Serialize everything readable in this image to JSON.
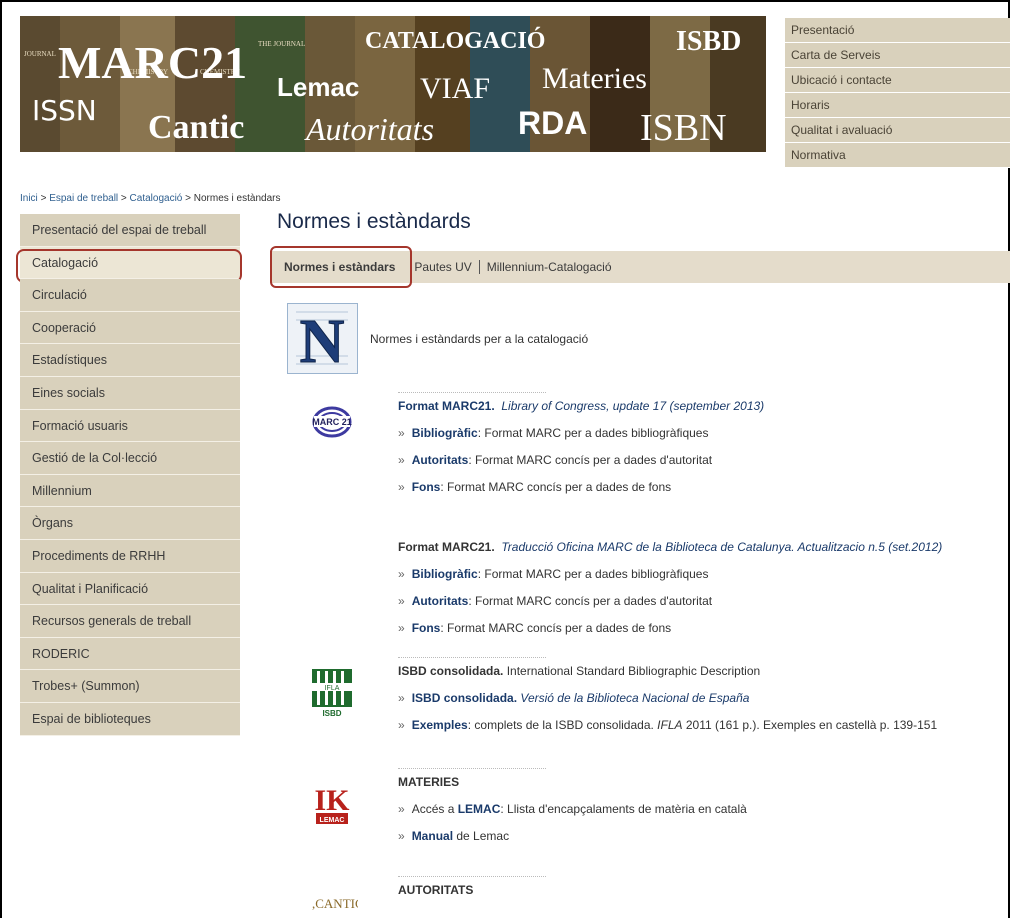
{
  "banner": {
    "words": [
      "MARC21",
      "CATALOGACIÓ",
      "ISBD",
      "Lemac",
      "VIAF",
      "Materies",
      "ISSN",
      "Cantic",
      "Autoritats",
      "RDA",
      "ISBN"
    ],
    "spine_texts": [
      "JOURNAL",
      "CHEMISTRY",
      "THE JOURNAL OF PHYSICAL CHEMISTRY",
      "CHEMISTRY"
    ]
  },
  "top_nav": [
    "Presentació",
    "Carta de Serveis",
    "Ubicació i contacte",
    "Horaris",
    "Qualitat i avaluació",
    "Normativa"
  ],
  "breadcrumb": {
    "items": [
      "Inici",
      "Espai de treball",
      "Catalogació"
    ],
    "sep": " > ",
    "current": "Normes i estàndars"
  },
  "sidebar": {
    "items": [
      "Presentació del espai de treball",
      "Catalogació",
      "Circulació",
      "Cooperació",
      "Estadístiques",
      "Eines socials",
      "Formació usuaris",
      "Gestió de la Col·lecció",
      "Millennium",
      "Òrgans",
      "Procediments de RRHH",
      "Qualitat i Planificació",
      "Recursos generals de treball",
      "RODERIC",
      "Trobes+ (Summon)",
      "Espai de biblioteques"
    ],
    "active_index": 1
  },
  "page_title": "Normes i estàndards",
  "tabs": [
    "Normes i estàndars",
    "Pautes UV",
    "Millennium-Catalogació"
  ],
  "intro": {
    "icon_letter": "N",
    "text": "Normes i estàndards per a la catalogació"
  },
  "sections": {
    "marc_loc": {
      "title": "Format MARC21.",
      "subtitle": "Library of Congress, update 17 (september 2013)",
      "logo_text": "MARC 21",
      "items": [
        {
          "link": "Bibliogràfic",
          "text": ": Format MARC per a dades bibliogràfiques"
        },
        {
          "link": "Autoritats",
          "text": ": Format MARC concís per a dades d'autoritat"
        },
        {
          "link": "Fons",
          "text": ": Format MARC concís per a dades de fons"
        }
      ]
    },
    "marc_bc": {
      "title": "Format MARC21.",
      "subtitle": "Traducció Oficina MARC de la Biblioteca de Catalunya. Actualitzacio n.5 (set.2012)",
      "items": [
        {
          "link": "Bibliogràfic",
          "text": ": Format MARC per a dades bibliogràfiques"
        },
        {
          "link": "Autoritats",
          "text": ": Format MARC concís per a dades d'autoritat"
        },
        {
          "link": "Fons",
          "text": ": Format MARC concís per a dades de fons"
        }
      ]
    },
    "isbd": {
      "title": "ISBD consolidada.",
      "subtitle": "International Standard Bibliographic Description",
      "logo_text_top": "IFLA",
      "logo_text_bottom": "ISBD",
      "item1_link": "ISBD consolidada.",
      "item1_text": "Versió de la Biblioteca Nacional de España",
      "item2_link": "Exemples",
      "item2_text_a": ": complets de la ISBD consolidada. ",
      "item2_text_i": "IFLA",
      "item2_text_b": " 2011 (161 p.). Exemples en castellà p. 139-151"
    },
    "materies": {
      "title": "MATERIES",
      "logo_text": "LEMAC",
      "item1_pre": "Accés a ",
      "item1_link": "LEMAC",
      "item1_text": ":  Llista d'encapçalaments de matèria en català",
      "item2_link": "Manual",
      "item2_text": " de Lemac"
    },
    "autoritats": {
      "title": "AUTORITATS",
      "logo_text": ",CANTIC,"
    }
  },
  "raquo": "»",
  "colors": {
    "accent": "#1a3a6a",
    "nav_bg": "#d9d1bc",
    "highlight": "#a5362c"
  }
}
